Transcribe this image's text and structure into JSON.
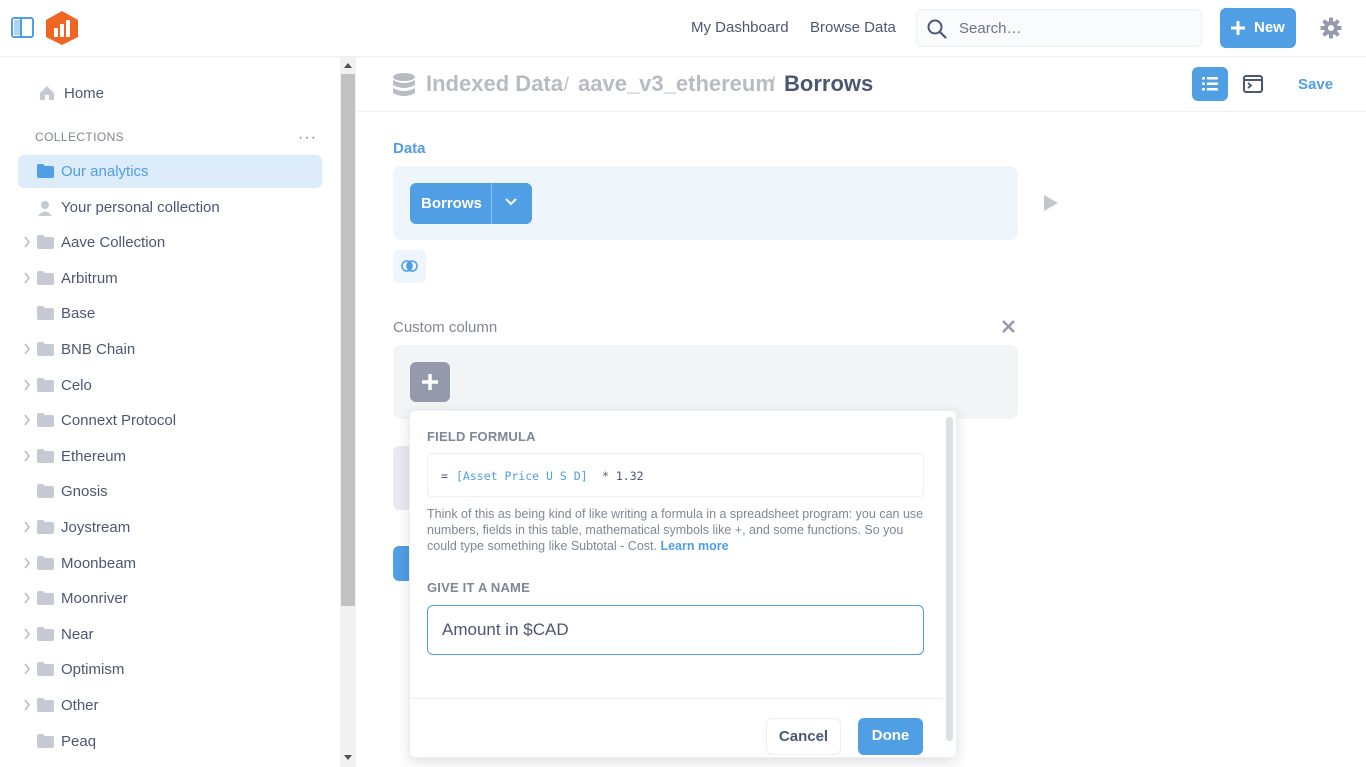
{
  "topbar": {
    "nav": [
      "My Dashboard",
      "Browse Data"
    ],
    "search_placeholder": "Search…",
    "new_label": "New"
  },
  "sidebar": {
    "home": "Home",
    "section": "COLLECTIONS",
    "items": [
      {
        "label": "Our analytics",
        "active": true,
        "chevron": false
      },
      {
        "label": "Your personal collection",
        "chevron": false
      },
      {
        "label": "Aave Collection",
        "chevron": true
      },
      {
        "label": "Arbitrum",
        "chevron": true
      },
      {
        "label": "Base",
        "chevron": false
      },
      {
        "label": "BNB Chain",
        "chevron": true
      },
      {
        "label": "Celo",
        "chevron": true
      },
      {
        "label": "Connext Protocol",
        "chevron": true
      },
      {
        "label": "Ethereum",
        "chevron": true
      },
      {
        "label": "Gnosis",
        "chevron": false
      },
      {
        "label": "Joystream",
        "chevron": true
      },
      {
        "label": "Moonbeam",
        "chevron": true
      },
      {
        "label": "Moonriver",
        "chevron": true
      },
      {
        "label": "Near",
        "chevron": true
      },
      {
        "label": "Optimism",
        "chevron": true
      },
      {
        "label": "Other",
        "chevron": true
      },
      {
        "label": "Peaq",
        "chevron": false
      }
    ]
  },
  "header": {
    "breadcrumb": [
      "Indexed Data",
      "aave_v3_ethereum",
      "Borrows"
    ],
    "save_label": "Save"
  },
  "notebook": {
    "data_label": "Data",
    "table_name": "Borrows",
    "custom_column_label": "Custom column"
  },
  "popover": {
    "formula_heading": "FIELD FORMULA",
    "formula_eq": "=",
    "formula_field": "[Asset Price U S D]",
    "formula_rest": "* 1.32",
    "help_text": "Think of this as being kind of like writing a formula in a spreadsheet program: you can use numbers, fields in this table, mathematical symbols like +, and some functions. So you could type something like Subtotal - Cost.",
    "learn_more": "Learn more",
    "name_heading": "GIVE IT A NAME",
    "name_value": "Amount in $CAD",
    "cancel_label": "Cancel",
    "done_label": "Done"
  },
  "colors": {
    "brand": "#509ee3",
    "text": "#4c5773",
    "muted": "#7f8795",
    "logo": "#f16522"
  }
}
